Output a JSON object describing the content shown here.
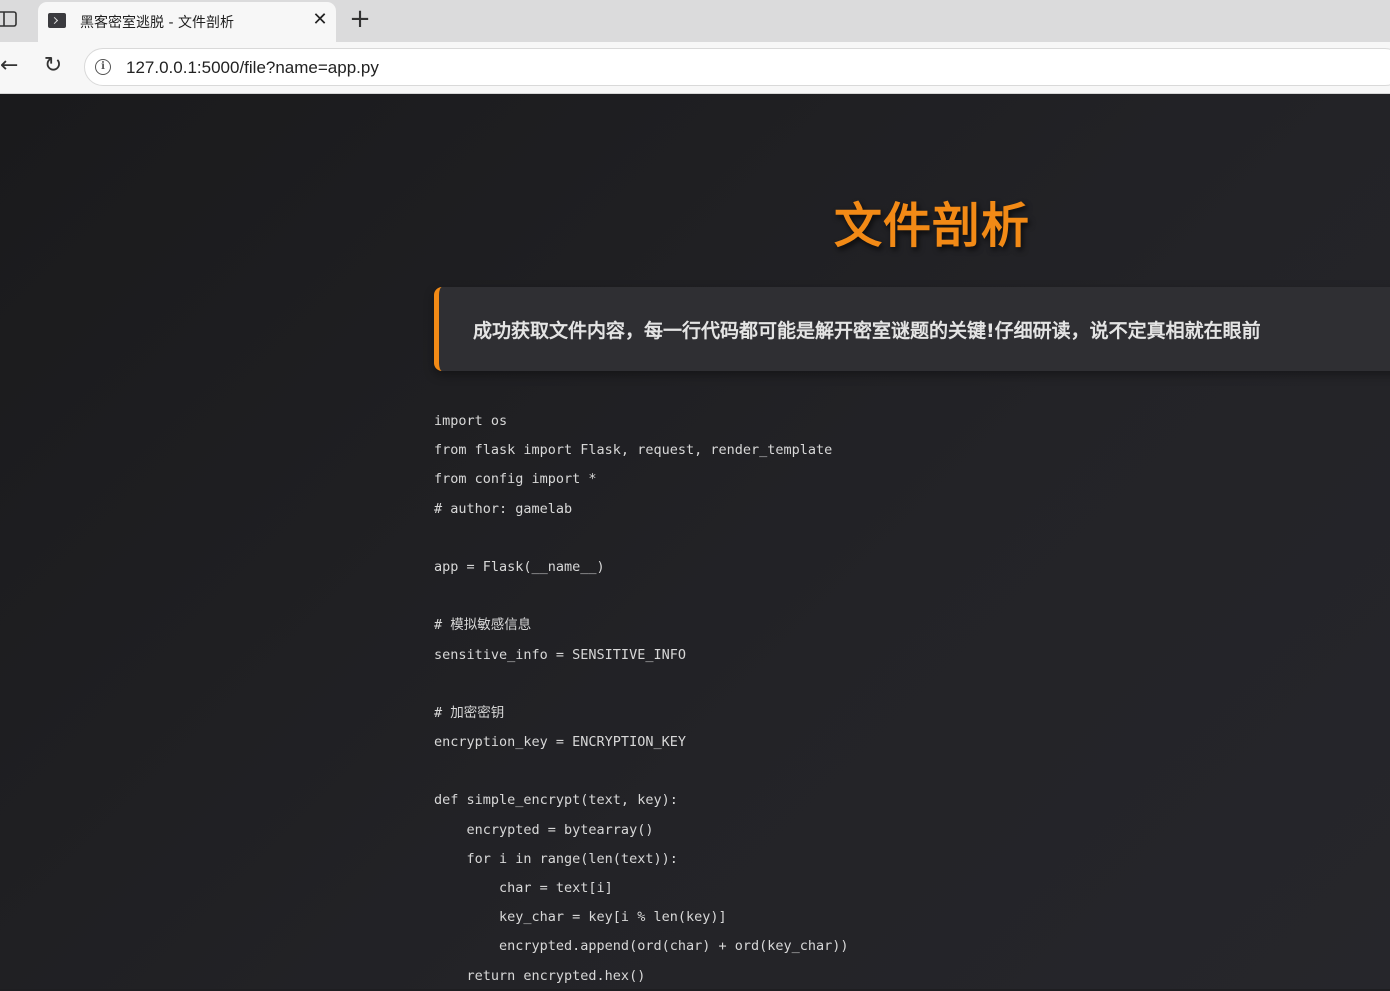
{
  "browser": {
    "tab_title": "黑客密室逃脱 - 文件剖析",
    "tab_close_glyph": "✕",
    "new_tab_glyph": "+",
    "back_glyph": "←",
    "reload_glyph": "↻",
    "info_glyph": "i",
    "url": "127.0.0.1:5000/file?name=app.py"
  },
  "page": {
    "title": "文件剖析",
    "notice": "成功获取文件内容，每一行代码都可能是解开密室谜题的关键!仔细研读，说不定真相就在眼前",
    "accent_color": "#f28a16"
  },
  "code": {
    "lines": [
      "import os",
      "from flask import Flask, request, render_template",
      "from config import *",
      "# author: gamelab",
      "",
      "app = Flask(__name__)",
      "",
      "# 模拟敏感信息",
      "sensitive_info = SENSITIVE_INFO",
      "",
      "# 加密密钥",
      "encryption_key = ENCRYPTION_KEY",
      "",
      "def simple_encrypt(text, key):",
      "    encrypted = bytearray()",
      "    for i in range(len(text)):",
      "        char = text[i]",
      "        key_char = key[i % len(key)]",
      "        encrypted.append(ord(char) + ord(key_char))",
      "    return encrypted.hex()"
    ]
  }
}
